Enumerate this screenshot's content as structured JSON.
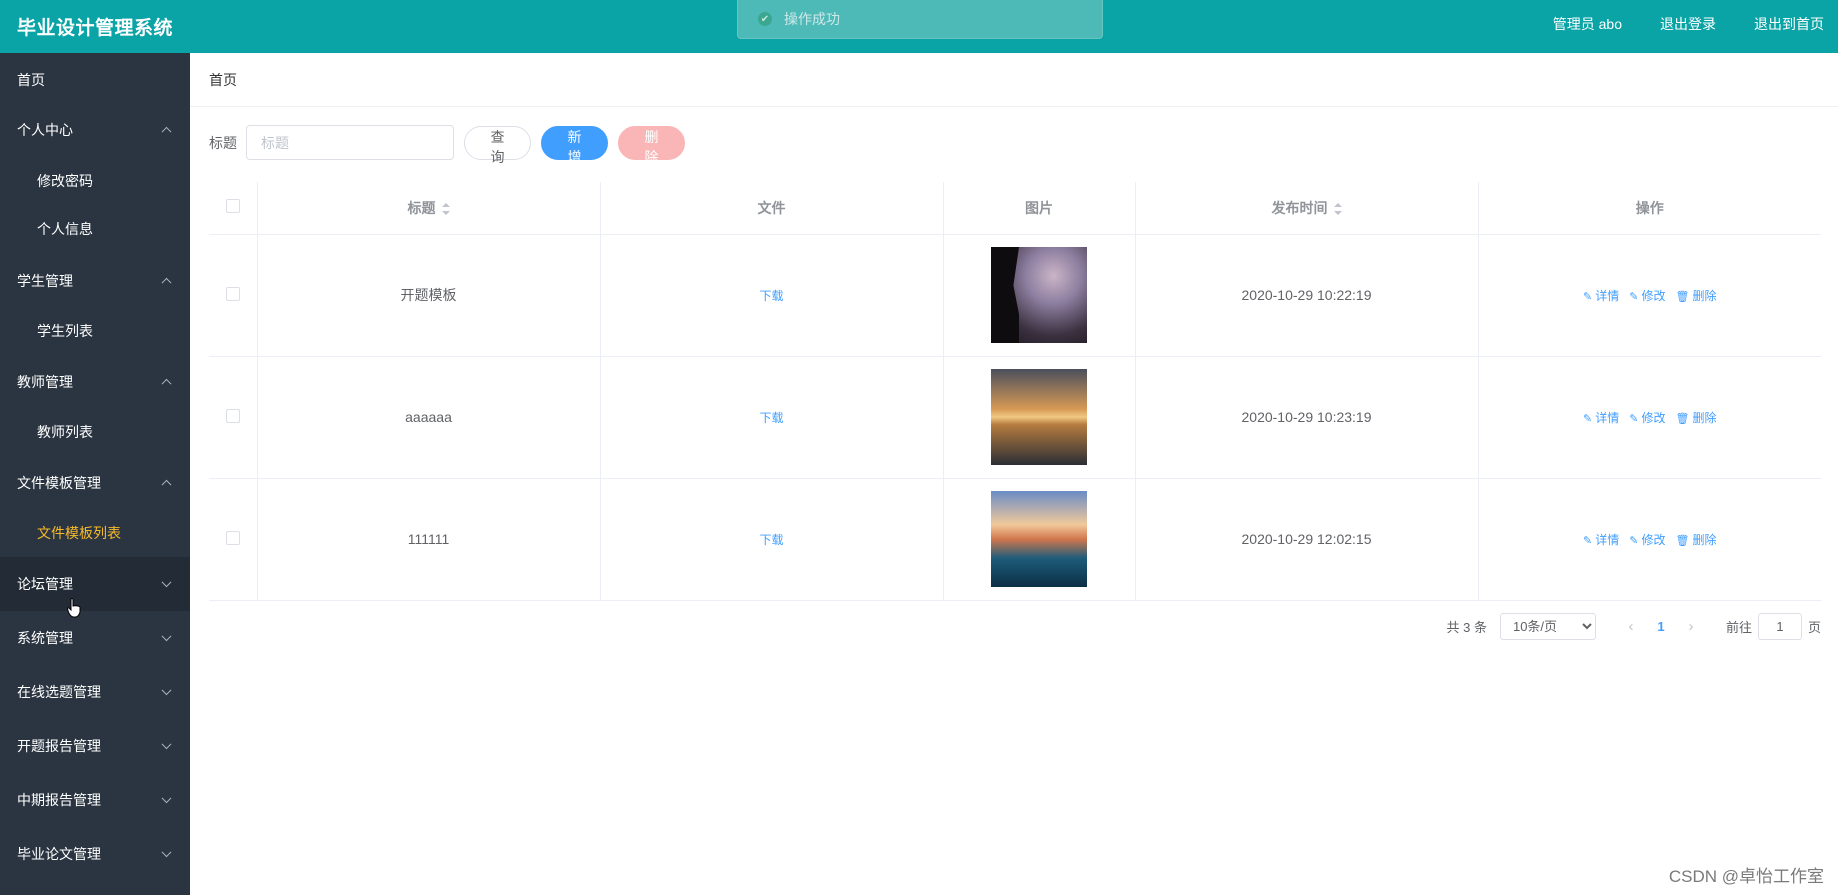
{
  "header": {
    "brand": "毕业设计管理系统",
    "admin": "管理员 abo",
    "logout": "退出登录",
    "home": "退出到首页"
  },
  "toast": {
    "text": "操作成功"
  },
  "sidebar": {
    "items": [
      {
        "label": "首页"
      },
      {
        "label": "个人中心"
      },
      {
        "label": "修改密码"
      },
      {
        "label": "个人信息"
      },
      {
        "label": "学生管理"
      },
      {
        "label": "学生列表"
      },
      {
        "label": "教师管理"
      },
      {
        "label": "教师列表"
      },
      {
        "label": "文件模板管理"
      },
      {
        "label": "文件模板列表"
      },
      {
        "label": "论坛管理"
      },
      {
        "label": "系统管理"
      },
      {
        "label": "在线选题管理"
      },
      {
        "label": "开题报告管理"
      },
      {
        "label": "中期报告管理"
      },
      {
        "label": "毕业论文管理"
      }
    ]
  },
  "breadcrumb": {
    "label": "首页"
  },
  "search": {
    "label": "标题",
    "placeholder": "标题",
    "query": "查询",
    "add": "新增",
    "delete": "删除"
  },
  "table": {
    "headers": [
      "标题",
      "文件",
      "图片",
      "发布时间",
      "操作"
    ],
    "rows": [
      {
        "title": "开题模板",
        "file": "下载",
        "time": "2020-10-29 10:22:19"
      },
      {
        "title": "aaaaaa",
        "file": "下载",
        "time": "2020-10-29 10:23:19"
      },
      {
        "title": "111111",
        "file": "下载",
        "time": "2020-10-29 12:02:15"
      }
    ],
    "ops": {
      "detail": "详情",
      "edit": "修改",
      "delete": "删除"
    }
  },
  "pager": {
    "total": "共 3 条",
    "page_size": "10条/页",
    "current": "1",
    "goto_prefix": "前往",
    "goto_value": "1",
    "goto_suffix": "页"
  },
  "watermark": "CSDN @卓怡工作室"
}
